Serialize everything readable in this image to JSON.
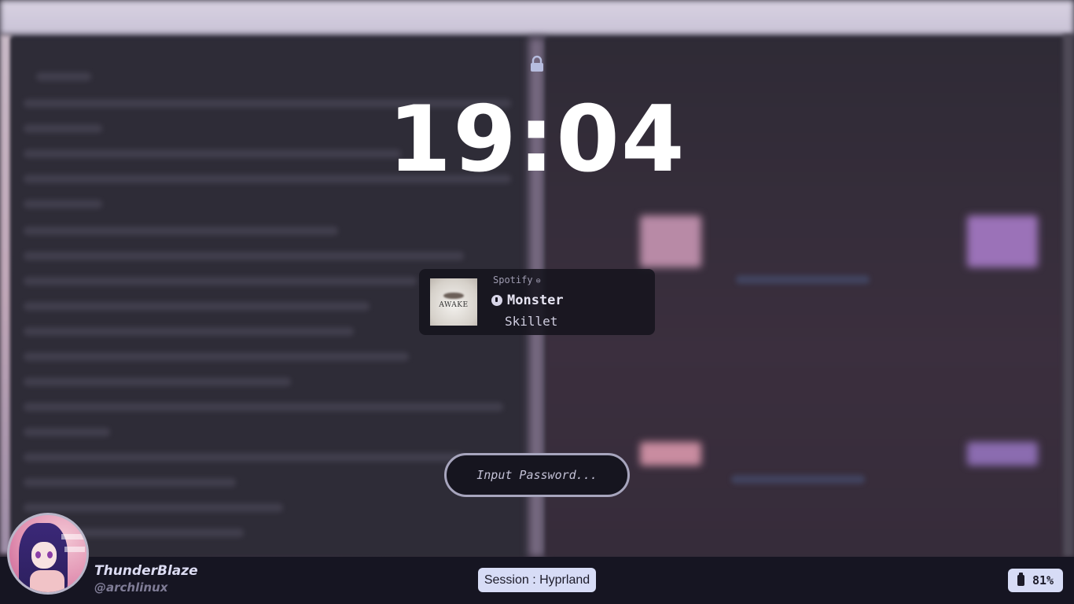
{
  "lockscreen": {
    "lock_icon": "lock-icon",
    "clock": "19:04"
  },
  "media": {
    "source": "Spotify",
    "source_dot": "⊜",
    "album_art_text": "AWAKE",
    "title": "Monster",
    "artist": "Skillet",
    "icon": "music-note-icon"
  },
  "password": {
    "placeholder": "Input Password..."
  },
  "user": {
    "name": "ThunderBlaze",
    "handle": "@archlinux"
  },
  "session": {
    "label": "Session : Hyprland"
  },
  "battery": {
    "icon": "battery-icon",
    "level": "81%"
  },
  "colors": {
    "badge_bg": "#d7dcf6",
    "bar_bg": "#161522",
    "field_border": "#a7a5bd"
  }
}
